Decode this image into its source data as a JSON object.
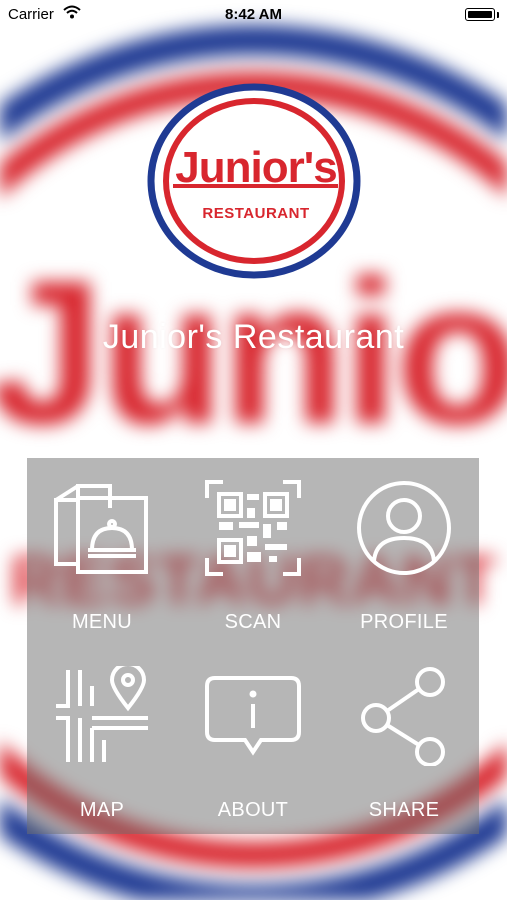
{
  "status_bar": {
    "carrier": "Carrier",
    "time": "8:42 AM",
    "wifi_icon": "wifi-icon",
    "battery_icon": "battery-icon"
  },
  "background": {
    "word": "Junior's",
    "subword": "RESTAURANT"
  },
  "logo": {
    "name": "Junior's",
    "subtitle": "RESTAURANT"
  },
  "app": {
    "title": "Junior's Restaurant"
  },
  "menu": {
    "items": [
      {
        "label": "MENU",
        "icon": "menu-cloche-icon"
      },
      {
        "label": "SCAN",
        "icon": "qr-code-icon"
      },
      {
        "label": "PROFILE",
        "icon": "profile-icon"
      },
      {
        "label": "MAP",
        "icon": "map-pin-icon"
      },
      {
        "label": "ABOUT",
        "icon": "info-bubble-icon"
      },
      {
        "label": "SHARE",
        "icon": "share-icon"
      }
    ]
  },
  "colors": {
    "brand_red": "#d8262e",
    "brand_blue": "#1f3a93",
    "panel_overlay": "rgba(110,110,110,0.50)",
    "text_white": "#ffffff"
  }
}
